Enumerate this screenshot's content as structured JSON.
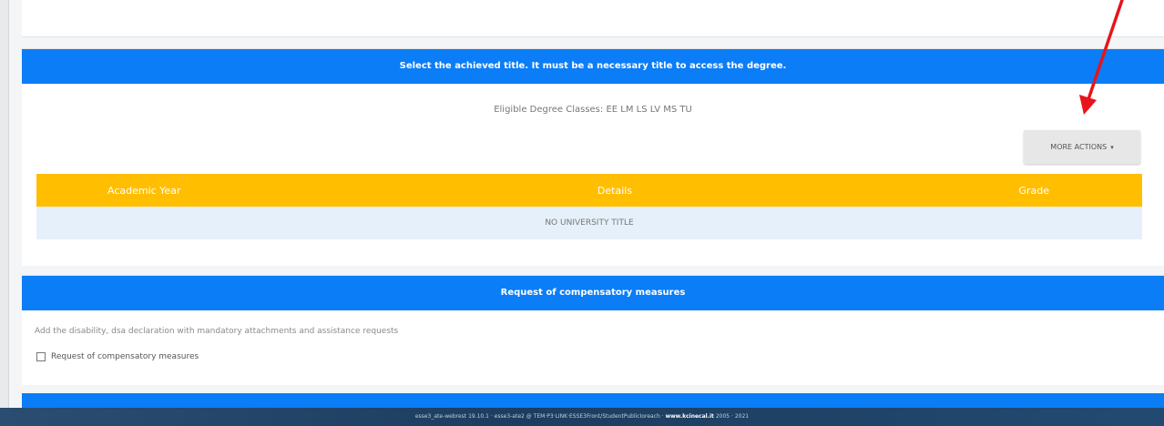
{
  "degree_section": {
    "header": "Select the achieved title. It must be a necessary title to access the degree.",
    "eligible_classes": "Eligible Degree Classes: EE LM LS LV MS TU",
    "more_actions_label": "MORE ACTIONS",
    "more_actions_caret": "▾",
    "table": {
      "columns": [
        "Academic Year",
        "Details",
        "Grade"
      ],
      "empty_row": "NO UNIVERSITY TITLE"
    }
  },
  "compensatory_section": {
    "header": "Request of compensatory measures",
    "description": "Add the disability, dsa declaration with mandatory attachments and assistance requests",
    "checkbox_label": "Request of compensatory measures",
    "checkbox_checked": false
  },
  "footer": {
    "text": "esse3_ate-webrest 19.10.1 · esse3-ate2 @ TEM·P3·LINK·ESSE3Front/StudentPublicIoreach ·",
    "brand": "www.kcinecal.it",
    "years": "2005 · 2021"
  },
  "annotation": {
    "arrow_color": "#e8141c"
  }
}
